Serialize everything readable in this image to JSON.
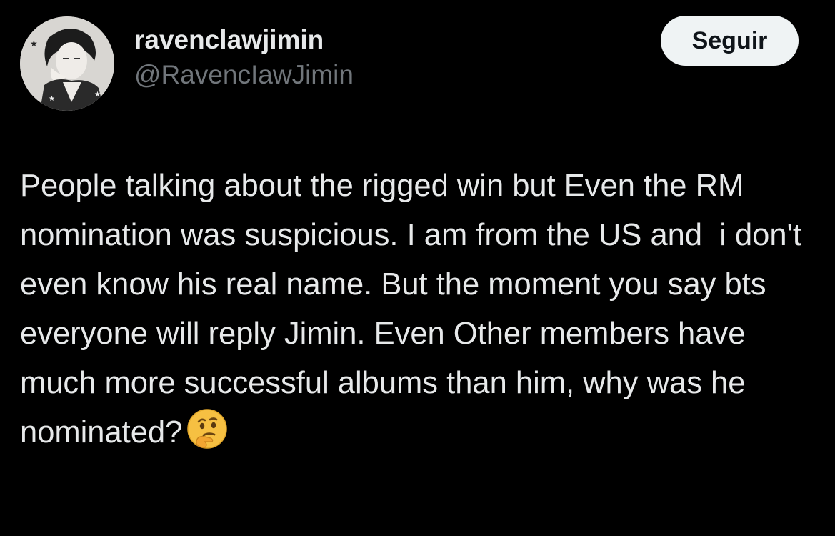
{
  "tweet": {
    "author": {
      "display_name": "ravenclawjimin",
      "handle": "@RavencIawJimin",
      "avatar_icon": "profile-photo-avatar"
    },
    "follow_label": "Seguir",
    "text": "People talking about the rigged win but Even the RM nomination was suspicious. I am from the US and  i don't even know his real name. But the moment you say bts everyone will reply Jimin. Even Other members have much more successful albums than him, why was he nominated?",
    "emoji_icon": "thinking-face-emoji",
    "colors": {
      "background": "#000000",
      "primary_text": "#e7e9ea",
      "secondary_text": "#71767b",
      "button_bg": "#eff3f4",
      "button_text": "#0f1419"
    }
  }
}
